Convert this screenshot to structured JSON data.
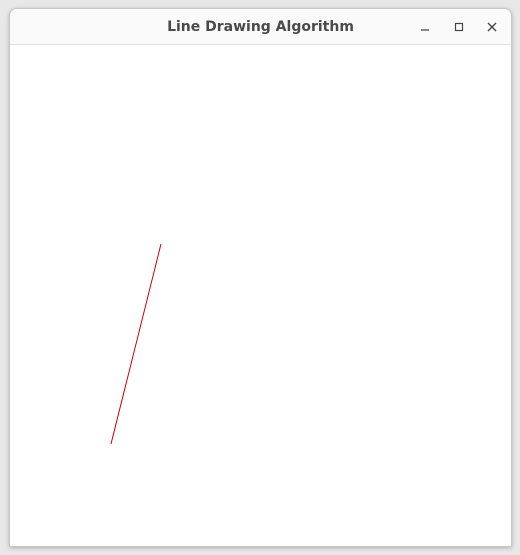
{
  "window": {
    "title": "Line Drawing Algorithm"
  },
  "controls": {
    "minimize_icon": "minimize-icon",
    "maximize_icon": "maximize-icon",
    "close_icon": "close-icon"
  },
  "canvas": {
    "background": "#ffffff",
    "line_color": "#cc0000"
  }
}
